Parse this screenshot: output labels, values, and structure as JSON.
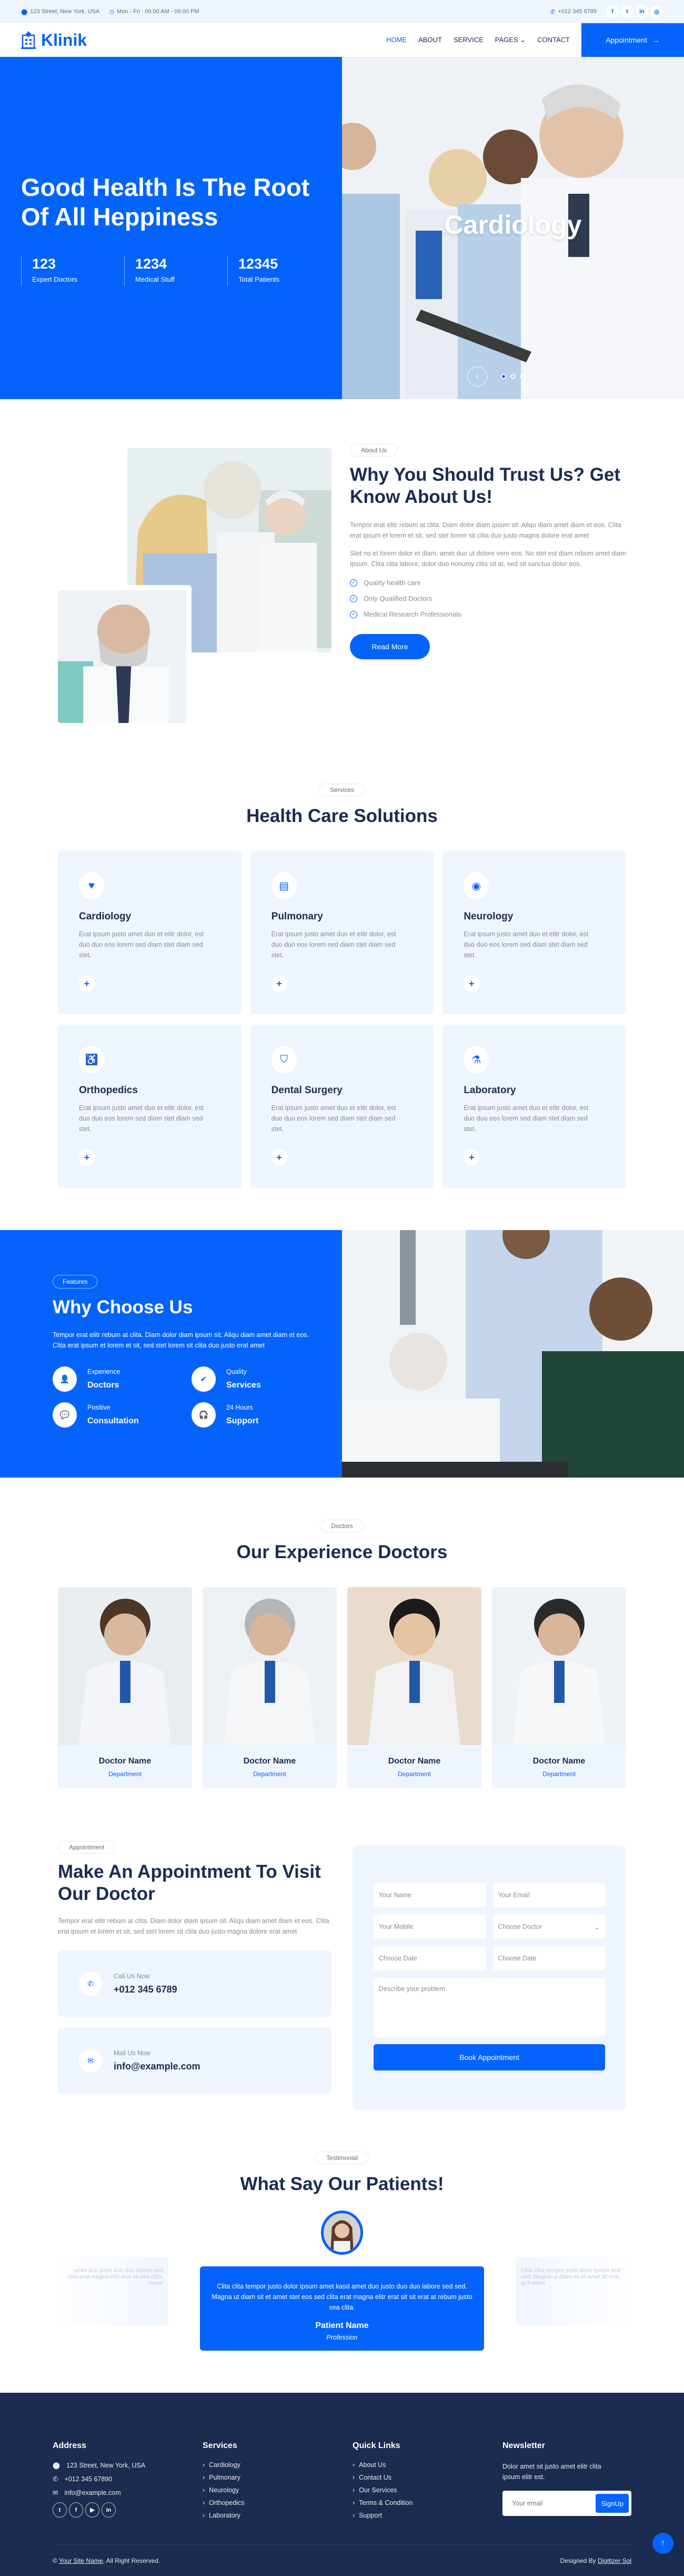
{
  "topbar": {
    "address": "123 Street, New York, USA",
    "hours": "Mon - Fri : 09.00 AM - 09.00 PM",
    "phone": "+012 345 6789",
    "socials": [
      {
        "icon": "facebook-icon",
        "glyph": "f"
      },
      {
        "icon": "twitter-icon",
        "glyph": "t"
      },
      {
        "icon": "linkedin-icon",
        "glyph": "in"
      },
      {
        "icon": "instagram-icon",
        "glyph": "◎"
      }
    ]
  },
  "nav": {
    "brand": "Klinik",
    "items": [
      {
        "label": "HOME",
        "active": true
      },
      {
        "label": "ABOUT"
      },
      {
        "label": "SERVICE"
      },
      {
        "label": "PAGES ⌄"
      },
      {
        "label": "CONTACT"
      }
    ],
    "cta": "Appointment",
    "cta_arrow": "→"
  },
  "hero": {
    "title": "Good Health Is The Root Of All Heppiness",
    "stats": [
      {
        "value": "123",
        "label": "Expert Doctors"
      },
      {
        "value": "1234",
        "label": "Medical Stuff"
      },
      {
        "value": "12345",
        "label": "Total Patients"
      }
    ],
    "slide_caption": "Cardiology",
    "prev": "‹",
    "next": "›",
    "slide_count": 3,
    "active_slide": 1
  },
  "about": {
    "pill": "About Us",
    "title": "Why You Should Trust Us? Get Know About Us!",
    "p1": "Tempor erat elitr rebum at clita. Diam dolor diam ipsum sit. Aliqu diam amet diam et eos. Clita erat ipsum et lorem et sit, sed stet lorem sit clita duo justo magna dolore erat amet",
    "p2": "Stet no et lorem dolor et diam, amet duo ut dolore vero eos. No stet est diam rebum amet diam ipsum. Clita clita labore, dolor duo nonumy clita sit at, sed sit sanctus dolor eos.",
    "checks": [
      "Quality health care",
      "Only Qualified Doctors",
      "Medical Research Professionals"
    ],
    "button": "Read More"
  },
  "services": {
    "pill": "Services",
    "title": "Health Care Solutions",
    "items": [
      {
        "name": "Cardiology",
        "icon": "heart-pulse-icon",
        "glyph": "♥",
        "text": "Erat ipsum justo amet duo et elitr dolor, est duo duo eos lorem sed diam stet diam sed stet."
      },
      {
        "name": "Pulmonary",
        "icon": "x-ray-icon",
        "glyph": "▤",
        "text": "Erat ipsum justo amet duo et elitr dolor, est duo duo eos lorem sed diam stet diam sed stet."
      },
      {
        "name": "Neurology",
        "icon": "brain-icon",
        "glyph": "◉",
        "text": "Erat ipsum justo amet duo et elitr dolor, est duo duo eos lorem sed diam stet diam sed stet."
      },
      {
        "name": "Orthopedics",
        "icon": "wheelchair-icon",
        "glyph": "♿",
        "text": "Erat ipsum justo amet duo et elitr dolor, est duo duo eos lorem sed diam stet diam sed stet."
      },
      {
        "name": "Dental Surgery",
        "icon": "tooth-icon",
        "glyph": "⛉",
        "text": "Erat ipsum justo amet duo et elitr dolor, est duo duo eos lorem sed diam stet diam sed stet."
      },
      {
        "name": "Laboratory",
        "icon": "vials-icon",
        "glyph": "⚗",
        "text": "Erat ipsum justo amet duo et elitr dolor, est duo duo eos lorem sed diam stet diam sed stet."
      }
    ],
    "plus": "+"
  },
  "features": {
    "pill": "Features",
    "title": "Why Choose Us",
    "text": "Tempor erat elitr rebum at clita. Diam dolor diam ipsum sit. Aliqu diam amet diam et eos. Clita erat ipsum et lorem et sit, sed stet lorem sit clita duo justo erat amet",
    "items": [
      {
        "top": "Experience",
        "bottom": "Doctors",
        "icon": "user-doctor-icon",
        "glyph": "👤"
      },
      {
        "top": "Quality",
        "bottom": "Services",
        "icon": "check-icon",
        "glyph": "✔"
      },
      {
        "top": "Positive",
        "bottom": "Consultation",
        "icon": "comment-medical-icon",
        "glyph": "💬"
      },
      {
        "top": "24 Hours",
        "bottom": "Support",
        "icon": "headphones-icon",
        "glyph": "🎧"
      }
    ]
  },
  "doctors": {
    "pill": "Doctors",
    "title": "Our Experience Doctors",
    "items": [
      {
        "name": "Doctor Name",
        "department": "Department"
      },
      {
        "name": "Doctor Name",
        "department": "Department"
      },
      {
        "name": "Doctor Name",
        "department": "Department"
      },
      {
        "name": "Doctor Name",
        "department": "Department"
      }
    ]
  },
  "appointment": {
    "pill": "Appointment",
    "title": "Make An Appointment To Visit Our Doctor",
    "text": "Tempor erat elitr rebum at clita. Diam dolor diam ipsum sit. Aliqu diam amet diam et eos. Clita erat ipsum et lorem et sit, sed stet lorem sit clita duo justo magna dolore erat amet",
    "call_label": "Call Us Now",
    "call_value": "+012 345 6789",
    "mail_label": "Mail Us Now",
    "mail_value": "info@example.com",
    "form": {
      "name_ph": "Your Name",
      "email_ph": "Your Email",
      "mobile_ph": "Your Mobile",
      "doctor_selected": "Choose Doctor",
      "date1_ph": "Choose Date",
      "date2_ph": "Choose Date",
      "problem_ph": "Describe your problem",
      "submit": "Book Appointment"
    }
  },
  "testimonial": {
    "pill": "Testimonial",
    "title": "What Say Our Patients!",
    "quote": "Clita clita tempor justo dolor ipsum amet kasd amet duo justo duo duo labore sed sed. Magna ut diam sit et amet stet eos sed clita erat magna elitr erat sit sit erat at rebum justo sea clita.",
    "name": "Patient Name",
    "profession": "Profession",
    "ghost_left": "amet duo justo duo duo labore sed clita erat magna elitr erat sit sea clita. Name",
    "ghost_right": "Clita clita tempor justo dolor ipsum sed sed. Magna ut diam sit et amet sit erat at Patient"
  },
  "footer": {
    "address_title": "Address",
    "address": "123 Street, New York, USA",
    "phone": "+012 345 67890",
    "email": "info@example.com",
    "socials": [
      {
        "icon": "twitter-icon",
        "glyph": "t"
      },
      {
        "icon": "facebook-icon",
        "glyph": "f"
      },
      {
        "icon": "youtube-icon",
        "glyph": "▶"
      },
      {
        "icon": "linkedin-icon",
        "glyph": "in"
      }
    ],
    "services_title": "Services",
    "services": [
      "Cardiology",
      "Pulmonary",
      "Neurology",
      "Orthopedics",
      "Laboratory"
    ],
    "links_title": "Quick Links",
    "links": [
      "About Us",
      "Contact Us",
      "Our Services",
      "Terms & Condition",
      "Support"
    ],
    "newsletter_title": "Newsletter",
    "newsletter_text": "Dolor amet sit justo amet elitr clita ipsum elitr est.",
    "newsletter_ph": "Your email",
    "newsletter_btn": "SignUp",
    "copyright_prefix": "©",
    "site_name": "Your Site Name",
    "copyright_suffix": ", All Right Reserved.",
    "designed_by": "Designed By",
    "designer": "Digitizer Sol",
    "to_top": "↑"
  }
}
